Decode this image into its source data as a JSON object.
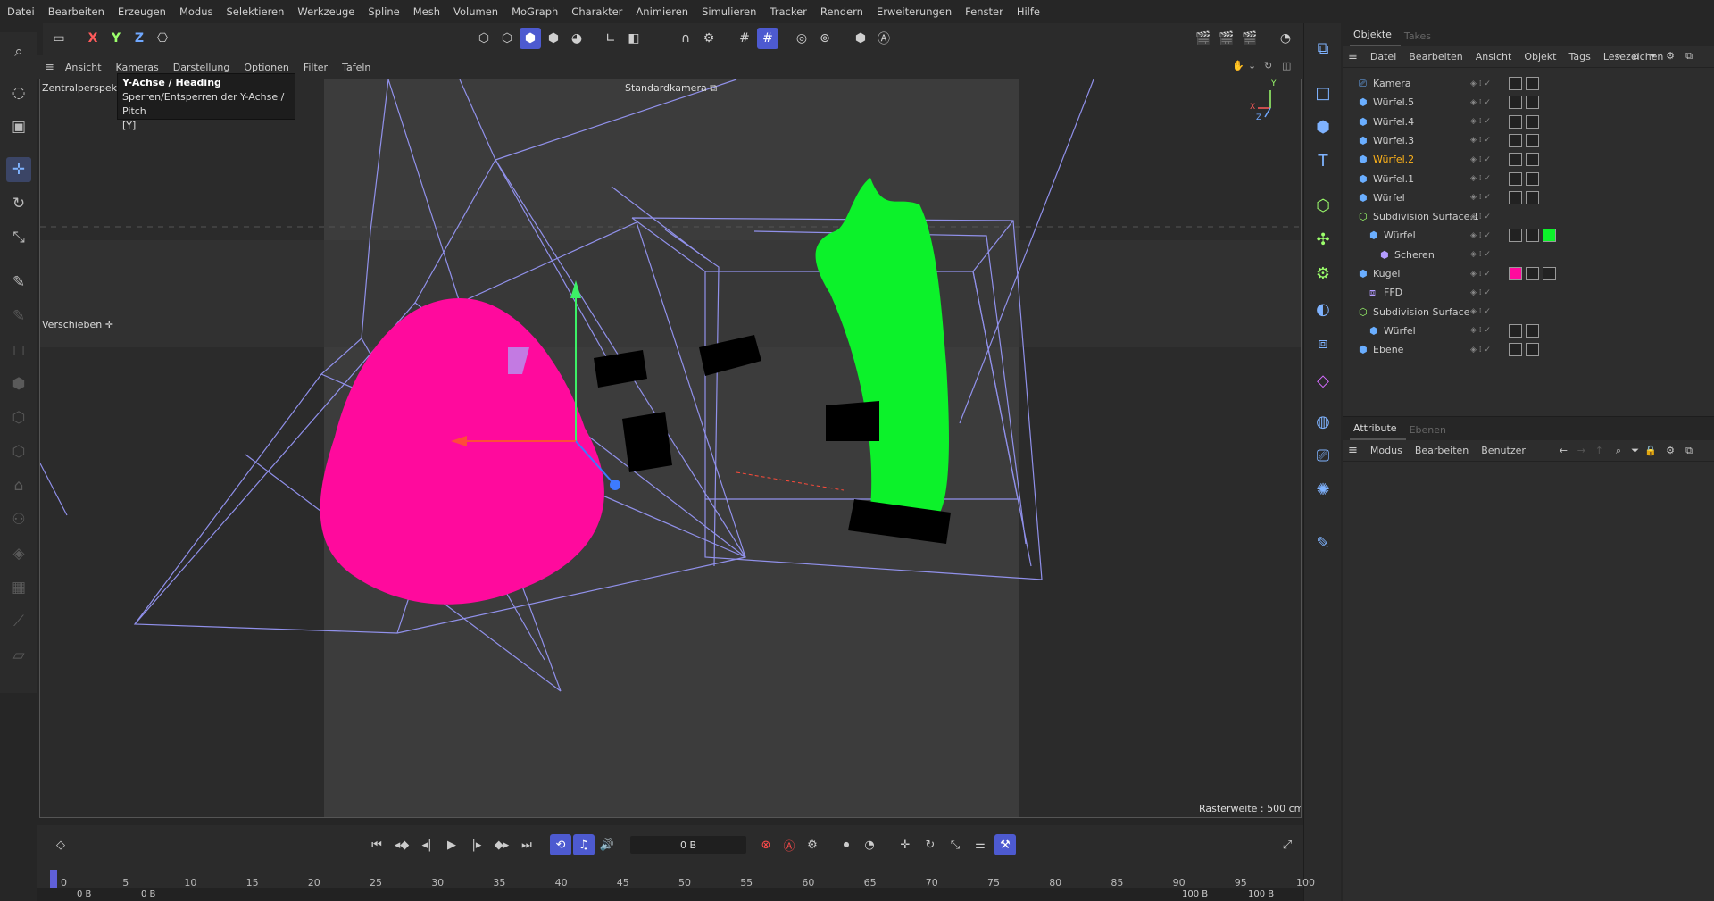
{
  "menubar": [
    "Datei",
    "Bearbeiten",
    "Erzeugen",
    "Modus",
    "Selektieren",
    "Werkzeuge",
    "Spline",
    "Mesh",
    "Volumen",
    "MoGraph",
    "Charakter",
    "Animieren",
    "Simulieren",
    "Tracker",
    "Rendern",
    "Erweiterungen",
    "Fenster",
    "Hilfe"
  ],
  "toolbar": {
    "axis_x": "X",
    "axis_y": "Y",
    "axis_z": "Z"
  },
  "viewport_menu": [
    "Ansicht",
    "Kameras",
    "Darstellung",
    "Optionen",
    "Filter",
    "Tafeln"
  ],
  "viewport": {
    "projection_label": "Zentralperspekti",
    "camera_label": "Standardkamera",
    "tool_label": "Verschieben",
    "grid_label": "Rasterweite : 500 cm",
    "axis_x": "X",
    "axis_y": "Y",
    "axis_z": "Z"
  },
  "tooltip": {
    "title": "Y-Achse / Heading",
    "desc": "Sperren/Entsperren der Y-Achse / Pitch",
    "shortcut": "[Y]"
  },
  "objects_panel": {
    "tabs": [
      "Objekte",
      "Takes"
    ],
    "menu": [
      "Datei",
      "Bearbeiten",
      "Ansicht",
      "Objekt",
      "Tags",
      "Lesezeichen"
    ],
    "items": [
      {
        "name": "Kamera",
        "indent": 0,
        "selected": false
      },
      {
        "name": "Würfel.5",
        "indent": 0,
        "selected": false
      },
      {
        "name": "Würfel.4",
        "indent": 0,
        "selected": false
      },
      {
        "name": "Würfel.3",
        "indent": 0,
        "selected": false
      },
      {
        "name": "Würfel.2",
        "indent": 0,
        "selected": true
      },
      {
        "name": "Würfel.1",
        "indent": 0,
        "selected": false
      },
      {
        "name": "Würfel",
        "indent": 0,
        "selected": false
      },
      {
        "name": "Subdivision Surface.1",
        "indent": 0,
        "selected": false
      },
      {
        "name": "Würfel",
        "indent": 1,
        "selected": false
      },
      {
        "name": "Scheren",
        "indent": 2,
        "selected": false
      },
      {
        "name": "Kugel",
        "indent": 0,
        "selected": false
      },
      {
        "name": "FFD",
        "indent": 1,
        "selected": false
      },
      {
        "name": "Subdivision Surface",
        "indent": 0,
        "selected": false
      },
      {
        "name": "Würfel",
        "indent": 1,
        "selected": false
      },
      {
        "name": "Ebene",
        "indent": 0,
        "selected": false
      }
    ]
  },
  "attributes_panel": {
    "tabs": [
      "Attribute",
      "Ebenen"
    ],
    "menu": [
      "Modus",
      "Bearbeiten",
      "Benutzer"
    ]
  },
  "timeline": {
    "current_frame": "0 B",
    "start": "0 B",
    "start2": "0 B",
    "end": "100 B",
    "end2": "100 B",
    "ticks": [
      "0",
      "5",
      "10",
      "15",
      "20",
      "25",
      "30",
      "35",
      "40",
      "45",
      "50",
      "55",
      "60",
      "65",
      "70",
      "75",
      "80",
      "85",
      "90",
      "95",
      "100"
    ]
  },
  "colors": {
    "pink": "#ff0a9d",
    "green": "#0cf22a",
    "accent": "#4d5ad0",
    "selected_text": "#ffb31a"
  }
}
